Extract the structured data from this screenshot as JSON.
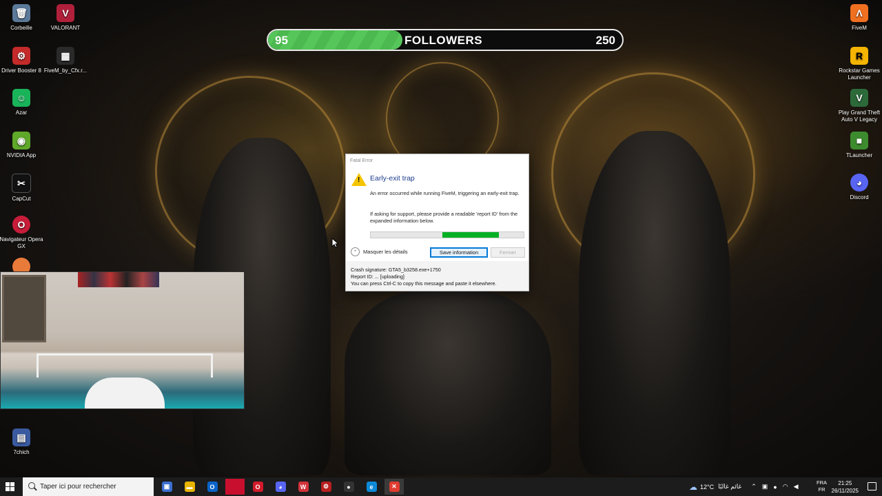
{
  "desktop_left": [
    {
      "label": "Corbeille",
      "icon": "recycle-bin-icon",
      "glyph": "🗑",
      "color": "#5b7a99"
    },
    {
      "label": "VALORANT",
      "icon": "valorant-icon",
      "glyph": "V",
      "color": "#b1203a"
    },
    {
      "label": "Driver Booster 8",
      "icon": "driver-booster-icon",
      "glyph": "⚙",
      "color": "#c42a2a"
    },
    {
      "label": "FiveM_by_Cfx.r...",
      "icon": "fivem-installer-icon",
      "glyph": "▦",
      "color": "#2a2a2a"
    },
    {
      "label": "Azar",
      "icon": "azar-icon",
      "glyph": "☺",
      "color": "#19b35a"
    },
    {
      "label": "NVIDIA App",
      "icon": "nvidia-icon",
      "glyph": "◉",
      "color": "#5fa82a"
    },
    {
      "label": "CapCut",
      "icon": "capcut-icon",
      "glyph": "✂",
      "color": "#111"
    },
    {
      "label": "Navigateur Opera GX",
      "icon": "opera-gx-icon",
      "glyph": "O",
      "color": "#c81d3a"
    },
    {
      "label": "7chich",
      "icon": "folder-7chich-icon",
      "glyph": "▤",
      "color": "#3a5aa0"
    }
  ],
  "desktop_right": [
    {
      "label": "FiveM",
      "icon": "fivem-icon",
      "glyph": "Λ",
      "color": "#f07020"
    },
    {
      "label": "Rockstar Games Launcher",
      "icon": "rockstar-icon",
      "glyph": "R",
      "color": "#f4b400"
    },
    {
      "label": "Play Grand Theft Auto V Legacy",
      "icon": "gta-v-icon",
      "glyph": "V",
      "color": "#2d6a3a"
    },
    {
      "label": "TLauncher",
      "icon": "tlauncher-icon",
      "glyph": "■",
      "color": "#3d8b2f"
    },
    {
      "label": "Discord",
      "icon": "discord-icon",
      "glyph": "◕",
      "color": "#5865f2"
    }
  ],
  "followers": {
    "current": "95",
    "label": "FOLLOWERS",
    "goal": "250",
    "progress": 0.38
  },
  "dialog": {
    "title": "Fatal Error",
    "heading": "Early-exit trap",
    "message": "An error occurred while running FiveM, triggering an early-exit trap.",
    "support": "If asking for support, please provide a readable 'report ID' from the expanded information below.",
    "progress_start": 0.47,
    "progress_end": 0.84,
    "toggle_label": "Masquer les détails",
    "save_button": "Save information",
    "close_button": "Fermer",
    "details": [
      "Crash signature: GTA5_b3258.exe+1750",
      "Report ID: ... [uploading]",
      "You can press Ctrl-C to copy this message and paste it elsewhere."
    ]
  },
  "taskbar": {
    "search_placeholder": "Taper ici pour rechercher",
    "apps": [
      {
        "name": "task-view-icon",
        "glyph": "▣",
        "color": "#3a6fd0"
      },
      {
        "name": "file-explorer-icon",
        "glyph": "▬",
        "color": "#e8b400"
      },
      {
        "name": "outlook-icon",
        "glyph": "O",
        "color": "#0a64c8"
      },
      {
        "name": "red-app-icon",
        "glyph": "",
        "color": "#c8102e"
      },
      {
        "name": "opera-icon",
        "glyph": "O",
        "color": "#d11a2a"
      },
      {
        "name": "discord-tb-icon",
        "glyph": "◕",
        "color": "#5865f2"
      },
      {
        "name": "wps-icon",
        "glyph": "W",
        "color": "#d0323a"
      },
      {
        "name": "driver-booster-tb-icon",
        "glyph": "⚙",
        "color": "#b81f1f"
      },
      {
        "name": "github-icon",
        "glyph": "●",
        "color": "#333"
      },
      {
        "name": "edge-icon",
        "glyph": "e",
        "color": "#0c8ad8"
      },
      {
        "name": "fivem-error-icon",
        "glyph": "✕",
        "color": "#e03c31"
      }
    ],
    "weather": "12°C",
    "weather_desc": "غائم غالبًا",
    "lang_top": "FRA",
    "lang_bottom": "FR",
    "time": "21:25",
    "date": "26/11/2025"
  }
}
